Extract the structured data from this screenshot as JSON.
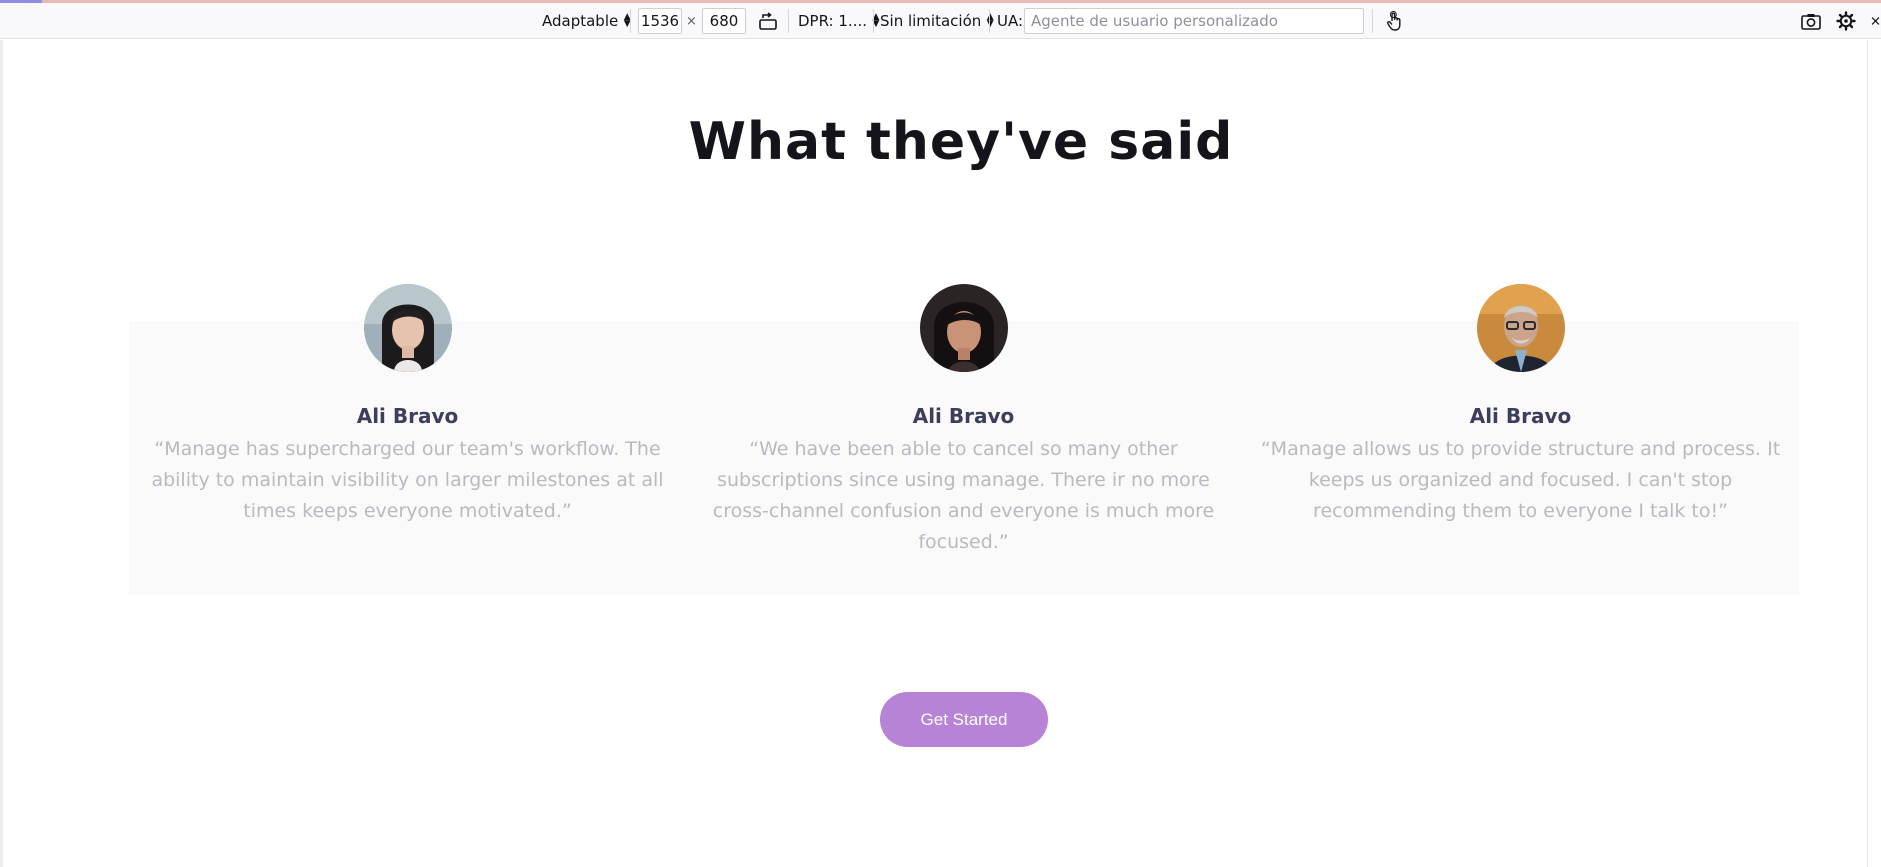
{
  "devtools": {
    "device_label": "Adaptable",
    "width_value": "1536",
    "times_sign": "×",
    "height_value": "680",
    "dpr_label": "DPR: 1....",
    "throttle_label": "Sin limitación",
    "ua_label": "UA:",
    "ua_placeholder": "Agente de usuario personalizado"
  },
  "page": {
    "heading": "What they've said",
    "testimonials": [
      {
        "name": "Ali Bravo",
        "quote": "“Manage has supercharged our team's workflow. The ability to maintain visibility on larger milestones at all times keeps everyone motivated.”"
      },
      {
        "name": "Ali Bravo",
        "quote": "“We have been able to cancel so many other subscriptions since using manage. There ir no more cross-channel confusion and everyone is much more focused.”"
      },
      {
        "name": "Ali Bravo",
        "quote": "“Manage allows us to provide structure and process. It keeps us organized and focused. I can't stop recommending them to everyone I talk to!”"
      }
    ],
    "cta_label": "Get Started"
  },
  "colors": {
    "heading": "#15141a",
    "name": "#3b3f5c",
    "quote": "#b9b9c3",
    "band": "#fafafa",
    "cta": "#b683d6"
  }
}
